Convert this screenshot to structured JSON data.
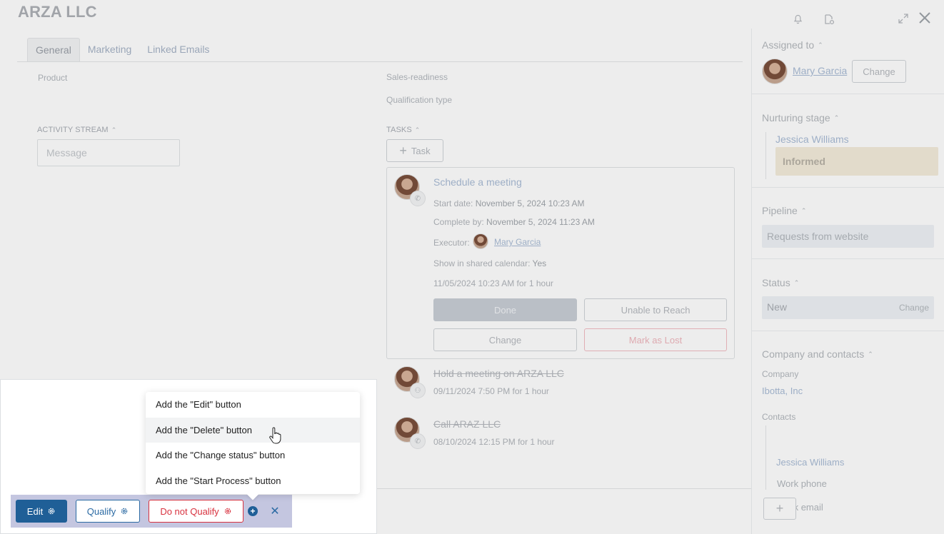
{
  "window": {
    "title": "ARZA LLC",
    "icons": [
      "bell-icon",
      "document-icon",
      "expand-icon",
      "close-icon"
    ]
  },
  "tabs": [
    {
      "label": "General",
      "active": true
    },
    {
      "label": "Marketing",
      "active": false
    },
    {
      "label": "Linked Emails",
      "active": false
    }
  ],
  "fields": {
    "product_label": "Product",
    "sales_readiness_label": "Sales-readiness",
    "qualification_type_label": "Qualification type"
  },
  "activity": {
    "title": "ACTIVITY STREAM",
    "message_placeholder": "Message"
  },
  "tasks": {
    "title": "TASKS",
    "add_label": "Task",
    "current": {
      "title": "Schedule a meeting",
      "start_label": "Start date:",
      "start_value": "November 5, 2024 10:23 AM",
      "complete_label": "Complete by:",
      "complete_value": "November 5, 2024 11:23 AM",
      "executor_label": "Executor:",
      "executor_name": "Mary Garcia",
      "calendar_label": "Show in shared calendar:",
      "calendar_value": "Yes",
      "time_info": "11/05/2024 10:23 AM for 1 hour",
      "buttons": {
        "done": "Done",
        "unable": "Unable to Reach",
        "change": "Change",
        "lost": "Mark as Lost"
      }
    },
    "history": [
      {
        "title": "Hold a meeting on ARZA LLC",
        "time": "09/11/2024 7:50 PM for 1 hour",
        "icon": "people-icon"
      },
      {
        "title": "Call ARAZ LLC",
        "time": "08/10/2024 12:15 PM for 1 hour",
        "icon": "phone-icon"
      }
    ]
  },
  "sidebar": {
    "assigned": {
      "title": "Assigned to",
      "name": "Mary Garcia",
      "change": "Change"
    },
    "nurturing": {
      "title": "Nurturing stage",
      "person": "Jessica Williams",
      "stage": "Informed"
    },
    "pipeline": {
      "title": "Pipeline",
      "value": "Requests from website"
    },
    "status": {
      "title": "Status",
      "value": "New",
      "change": "Change"
    },
    "company": {
      "title": "Company and contacts",
      "company_label": "Company",
      "company_value": "Ibotta, Inc",
      "contacts_label": "Contacts",
      "contact_name": "Jessica Williams",
      "work_phone": "Work phone",
      "work_email": "Work email",
      "add": "+"
    }
  },
  "bottom_bar": {
    "edit": "Edit",
    "qualify": "Qualify",
    "dnq": "Do not Qualify",
    "colors": {
      "edit": "#1f5f97",
      "qualify": "#2b6aa3",
      "dnq": "#d8323f",
      "bar": "#c4c6e0"
    }
  },
  "menu": {
    "items": [
      "Add the \"Edit\" button",
      "Add the \"Delete\" button",
      "Add the \"Change status\" button",
      "Add the \"Start Process\" button"
    ],
    "hovered_index": 1
  }
}
